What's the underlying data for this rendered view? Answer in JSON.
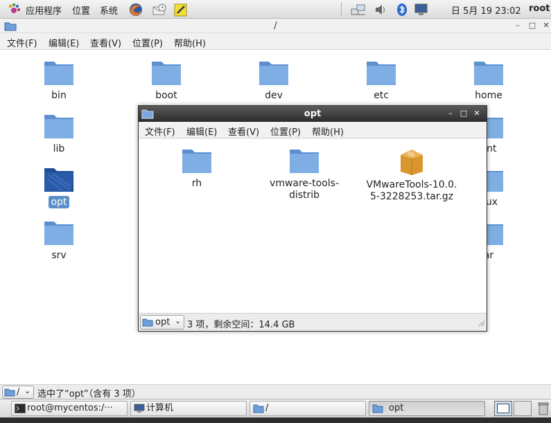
{
  "top_panel": {
    "applications": "应用程序",
    "places": "位置",
    "system": "系统",
    "clock": "日 5月 19 23:02",
    "user": "root"
  },
  "main_window": {
    "title": "/",
    "menu": [
      "文件(F)",
      "编辑(E)",
      "查看(V)",
      "位置(P)",
      "帮助(H)"
    ],
    "icons": [
      {
        "label": "bin"
      },
      {
        "label": "boot"
      },
      {
        "label": "dev"
      },
      {
        "label": "etc"
      },
      {
        "label": "home"
      },
      {
        "label": "lib"
      },
      {
        "label": "ant"
      },
      {
        "label": "opt"
      },
      {
        "label": "nux"
      },
      {
        "label": "srv"
      },
      {
        "label": "ar"
      }
    ],
    "status": {
      "path": "/",
      "text": "选中了“opt”（含有 3 项）"
    }
  },
  "opt_window": {
    "title": "opt",
    "menu": [
      "文件(F)",
      "编辑(E)",
      "查看(V)",
      "位置(P)",
      "帮助(H)"
    ],
    "items": [
      {
        "label": "rh",
        "type": "folder"
      },
      {
        "label_line1": "vmware-tools-",
        "label_line2": "distrib",
        "type": "folder"
      },
      {
        "label_line1": "VMwareTools-10.0.",
        "label_line2": "5-3228253.tar.gz",
        "type": "archive"
      }
    ],
    "status": {
      "location": "opt",
      "text": "3 项，剩余空间：14.4 GB"
    }
  },
  "taskbar": {
    "items": [
      {
        "label": "root@mycentos:/···",
        "icon": "terminal-icon"
      },
      {
        "label": "计算机",
        "icon": "computer-icon"
      },
      {
        "label": "/",
        "icon": "folder-icon"
      },
      {
        "label": "opt",
        "icon": "folder-icon",
        "active": true
      }
    ]
  },
  "colors": {
    "folder": "#6f9fd8",
    "folder_selected": "#2a5aa8",
    "selection": "#5a8fc9",
    "titlebar_dark": "#3a3a3a"
  }
}
